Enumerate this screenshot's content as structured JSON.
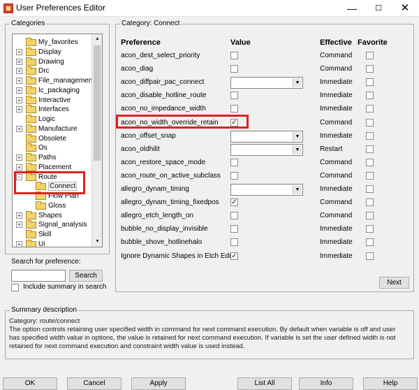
{
  "window": {
    "title": "User Preferences Editor",
    "minimize_glyph": "—",
    "maximize_glyph": "☐",
    "close_glyph": "✕"
  },
  "categories": {
    "label": "Categories",
    "items": [
      {
        "label": "My_favorites",
        "expander": ""
      },
      {
        "label": "Display",
        "expander": "+"
      },
      {
        "label": "Drawing",
        "expander": "+"
      },
      {
        "label": "Drc",
        "expander": "+"
      },
      {
        "label": "File_management",
        "expander": "+"
      },
      {
        "label": "Ic_packaging",
        "expander": "+"
      },
      {
        "label": "Interactive",
        "expander": "+"
      },
      {
        "label": "Interfaces",
        "expander": "+"
      },
      {
        "label": "Logic",
        "expander": ""
      },
      {
        "label": "Manufacture",
        "expander": "+"
      },
      {
        "label": "Obsolete",
        "expander": ""
      },
      {
        "label": "Os",
        "expander": ""
      },
      {
        "label": "Paths",
        "expander": "+"
      },
      {
        "label": "Placement",
        "expander": "+"
      },
      {
        "label": "Route",
        "expander": "−"
      },
      {
        "label": "Connect",
        "expander": ""
      },
      {
        "label": "Flow Plan",
        "expander": ""
      },
      {
        "label": "Gloss",
        "expander": ""
      },
      {
        "label": "Shapes",
        "expander": "+"
      },
      {
        "label": "Signal_analysis",
        "expander": "+"
      },
      {
        "label": "Skill",
        "expander": ""
      },
      {
        "label": "Ui",
        "expander": "+"
      }
    ],
    "scroll_up": "▲",
    "scroll_down": "▼"
  },
  "search": {
    "label": "Search for preference:",
    "button": "Search",
    "include_summary_label": "Include summary in search"
  },
  "category_panel": {
    "label": "Category:  Connect",
    "headers": {
      "preference": "Preference",
      "value": "Value",
      "effective": "Effective",
      "favorite": "Favorite"
    },
    "rows": [
      {
        "name": "acon_dest_select_priority",
        "control": "checkbox",
        "checked": false,
        "effective": "Command"
      },
      {
        "name": "acon_diag",
        "control": "checkbox",
        "checked": false,
        "effective": "Command"
      },
      {
        "name": "acon_diffpair_pac_connect",
        "control": "combo",
        "effective": "Immediate"
      },
      {
        "name": "acon_disable_hotline_route",
        "control": "checkbox",
        "checked": false,
        "effective": "Immediate"
      },
      {
        "name": "acon_no_impedance_width",
        "control": "checkbox",
        "checked": false,
        "effective": "Immediate"
      },
      {
        "name": "acon_no_width_override_retain",
        "control": "checkbox",
        "checked": true,
        "effective": "Command"
      },
      {
        "name": "acon_offset_snap",
        "control": "combo",
        "effective": "Immediate"
      },
      {
        "name": "acon_oldhilit",
        "control": "combo",
        "effective": "Restart"
      },
      {
        "name": "acon_restore_space_mode",
        "control": "checkbox",
        "checked": false,
        "effective": "Command"
      },
      {
        "name": "acon_route_on_active_subclass",
        "control": "checkbox",
        "checked": false,
        "effective": "Command"
      },
      {
        "name": "allegro_dynam_timing",
        "control": "combo",
        "effective": "Immediate"
      },
      {
        "name": "allegro_dynam_timing_fixedpos",
        "control": "checkbox",
        "checked": true,
        "effective": "Command"
      },
      {
        "name": "allegro_etch_length_on",
        "control": "checkbox",
        "checked": false,
        "effective": "Command"
      },
      {
        "name": "bubble_no_display_invisible",
        "control": "checkbox",
        "checked": false,
        "effective": "Immediate"
      },
      {
        "name": "bubble_shove_hotlinehalo",
        "control": "checkbox",
        "checked": false,
        "effective": "Immediate"
      },
      {
        "name": "Ignore Dynamic Shapes in Etch Edit",
        "control": "checkbox",
        "checked": true,
        "effective": "Immediate"
      }
    ],
    "next_button": "Next"
  },
  "summary": {
    "label": "Summary description",
    "lines": [
      "Category: route/connect",
      "The option controls retaining user specified width in command for next command execution. By default when variable is off and user",
      "has specified width value in options, the value is retained for next command execution. If variable is set the user defined width is not",
      "retained for next command execution and constraint width value is used instead."
    ]
  },
  "buttons": {
    "ok": "OK",
    "cancel": "Cancel",
    "apply": "Apply",
    "list_all": "List All",
    "info": "Info",
    "help": "Help"
  },
  "glyphs": {
    "check": "✓",
    "combo_arrow": "▼"
  },
  "colors": {
    "highlight": "#e02020",
    "folder": "#f2d36b"
  }
}
